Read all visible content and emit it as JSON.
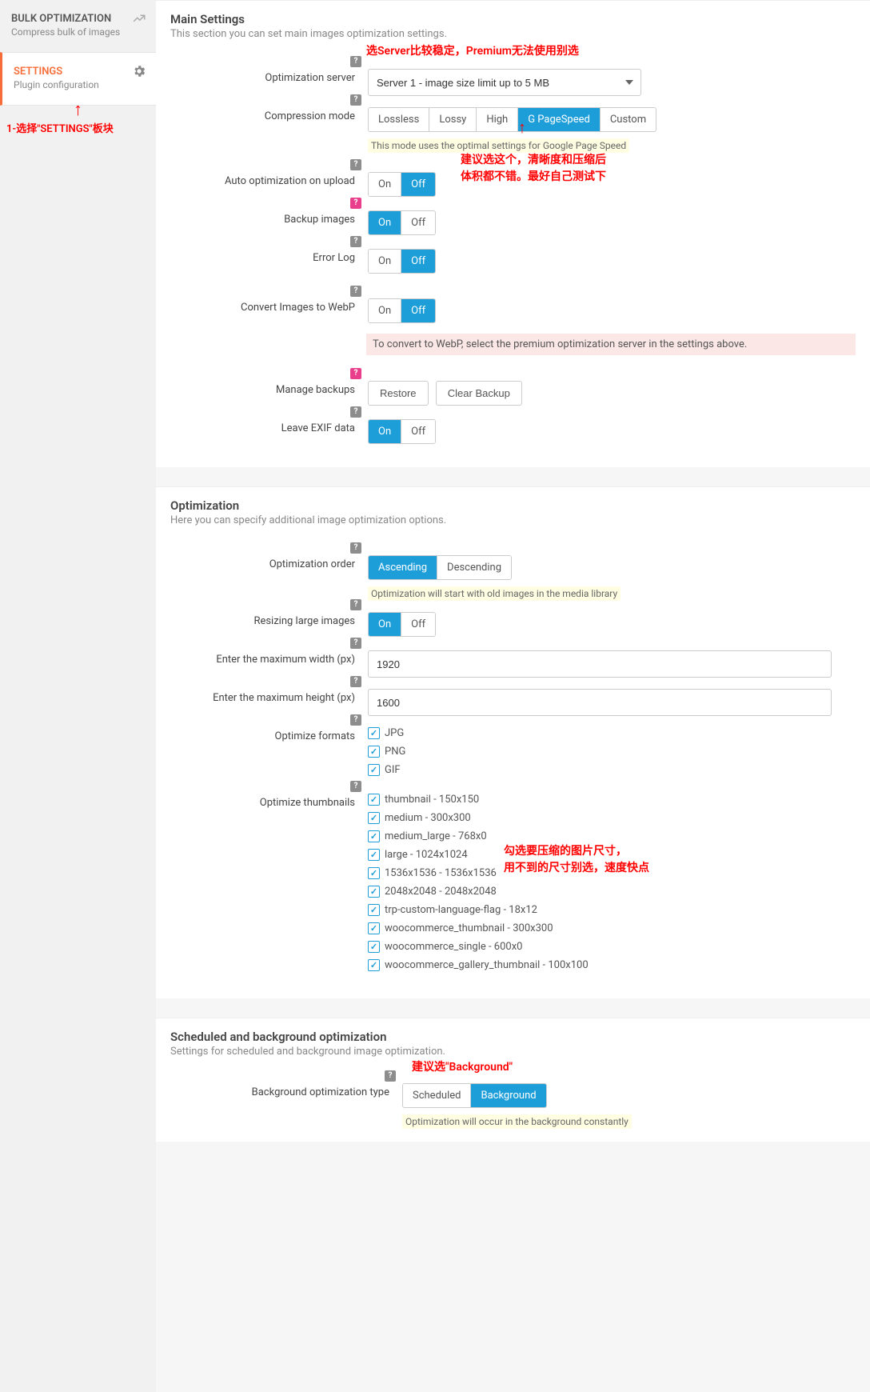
{
  "sidebar": {
    "bulk": {
      "title": "BULK OPTIMIZATION",
      "sub": "Compress bulk of images"
    },
    "settings": {
      "title": "SETTINGS",
      "sub": "Plugin configuration"
    },
    "arrow": "↑",
    "note": "1-选择\"SETTINGS\"板块"
  },
  "annot": {
    "server": "选Server比较稳定，Premium无法使用别选",
    "mode_arrow": "↑",
    "mode_l1": "建议选这个，清晰度和压缩后",
    "mode_l2": "体积都不错。最好自己测试下",
    "thumbs_l1": "勾选要压缩的图片尺寸，",
    "thumbs_l2": "用不到的尺寸别选，速度快点",
    "bg": "建议选\"Background\""
  },
  "sections": {
    "main": {
      "title": "Main Settings",
      "desc": "This section you can set main images optimization settings."
    },
    "opt": {
      "title": "Optimization",
      "desc": "Here you can specify additional image optimization options."
    },
    "sched": {
      "title": "Scheduled and background optimization",
      "desc": "Settings for scheduled and background image optimization."
    }
  },
  "labels": {
    "server": "Optimization server",
    "mode": "Compression mode",
    "auto": "Auto optimization on upload",
    "backup": "Backup images",
    "errlog": "Error Log",
    "webp": "Convert Images to WebP",
    "manage": "Manage backups",
    "exif": "Leave EXIF data",
    "order": "Optimization order",
    "resize": "Resizing large images",
    "maxw": "Enter the maximum width (px)",
    "maxh": "Enter the maximum height (px)",
    "formats": "Optimize formats",
    "thumbs": "Optimize thumbnails",
    "bgtype": "Background optimization type"
  },
  "values": {
    "server": "Server 1 - image size limit up to 5 MB",
    "modes": [
      "Lossless",
      "Lossy",
      "High",
      "G PageSpeed",
      "Custom"
    ],
    "mode_hint": "This mode uses the optimal settings for Google Page Speed",
    "on": "On",
    "off": "Off",
    "webp_hint": "To convert to WebP, select the premium optimization server in the settings above.",
    "restore": "Restore",
    "clear": "Clear Backup",
    "order_opts": [
      "Ascending",
      "Descending"
    ],
    "order_hint": "Optimization will start with old images in the media library",
    "maxw": "1920",
    "maxh": "1600",
    "formats": [
      "JPG",
      "PNG",
      "GIF"
    ],
    "thumbs": [
      "thumbnail - 150x150",
      "medium - 300x300",
      "medium_large - 768x0",
      "large - 1024x1024",
      "1536x1536 - 1536x1536",
      "2048x2048 - 2048x2048",
      "trp-custom-language-flag - 18x12",
      "woocommerce_thumbnail - 300x300",
      "woocommerce_single - 600x0",
      "woocommerce_gallery_thumbnail - 100x100"
    ],
    "bg_opts": [
      "Scheduled",
      "Background"
    ],
    "bg_hint": "Optimization will occur in the background constantly"
  }
}
